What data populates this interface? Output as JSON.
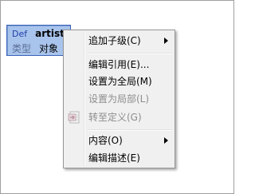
{
  "node": {
    "def_label": "Def",
    "name": "artist",
    "type_label": "类型",
    "type_value": "对象"
  },
  "menu": {
    "items": [
      {
        "label": "追加子级(C)",
        "enabled": true,
        "submenu": true
      },
      {
        "label": "编辑引用(E)...",
        "enabled": true,
        "submenu": false
      },
      {
        "label": "设置为全局(M)",
        "enabled": true,
        "submenu": false
      },
      {
        "label": "设置为局部(L)",
        "enabled": false,
        "submenu": false
      },
      {
        "label": "转至定义(G)",
        "enabled": false,
        "submenu": false,
        "icon": "go-to-definition-icon"
      },
      {
        "label": "内容(O)",
        "enabled": true,
        "submenu": true
      },
      {
        "label": "编辑描述(E)",
        "enabled": true,
        "submenu": false
      }
    ]
  },
  "colors": {
    "node_fill": "#a9c4ec",
    "node_border": "#3a62b8",
    "menu_bg": "#f0f0f0",
    "disabled_text": "#8d8d8d"
  }
}
